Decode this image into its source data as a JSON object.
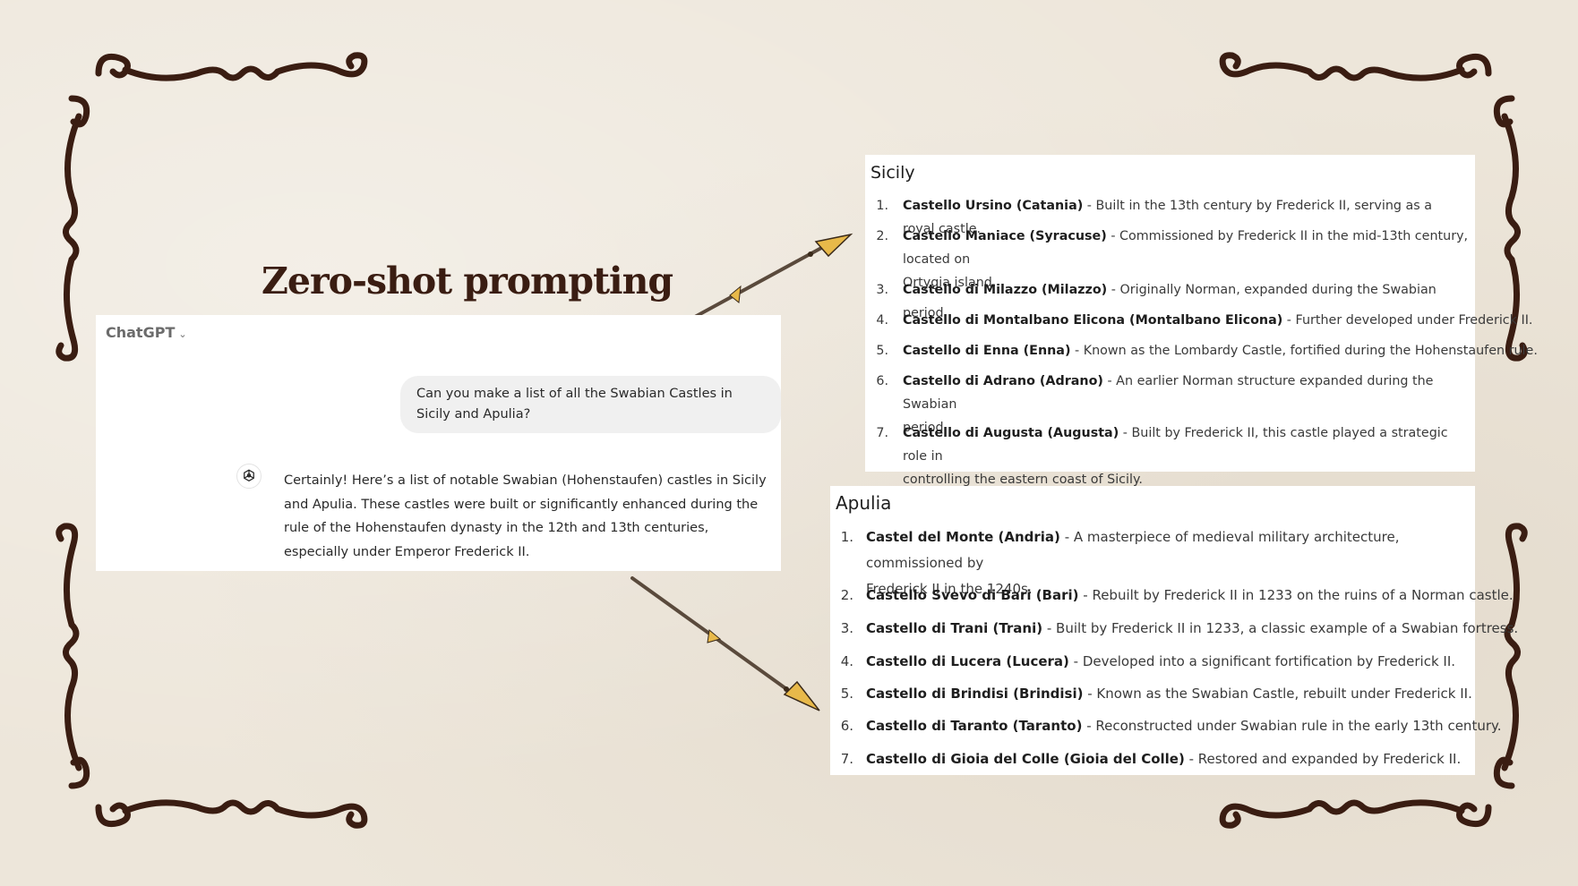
{
  "title": "Zero-shot prompting",
  "chat": {
    "model_label": "ChatGPT",
    "model_chevron": "⌄",
    "user_message": "Can you make a list of all the Swabian Castles in Sicily and Apulia?",
    "assistant_message": "Certainly! Here’s a list of notable Swabian (Hohenstaufen) castles in Sicily and Apulia. These castles were built or significantly enhanced during the rule of the Hohenstaufen dynasty in the 12th and 13th centuries, especially under Emperor Frederick II."
  },
  "sicily": {
    "heading": "Sicily",
    "items": [
      {
        "num": "1.",
        "name": "Castello Ursino (Catania)",
        "desc": " - Built in the 13th century by Frederick II, serving as a royal castle.",
        "cont": ""
      },
      {
        "num": "2.",
        "name": "Castello Maniace (Syracuse)",
        "desc": " - Commissioned by Frederick II in the mid-13th century, located on",
        "cont": "Ortygia island."
      },
      {
        "num": "3.",
        "name": "Castello di Milazzo (Milazzo)",
        "desc": " - Originally Norman, expanded during the Swabian period.",
        "cont": ""
      },
      {
        "num": "4.",
        "name": "Castello di Montalbano Elicona (Montalbano Elicona)",
        "desc": " - Further developed under Frederick II.",
        "cont": ""
      },
      {
        "num": "5.",
        "name": "Castello di Enna (Enna)",
        "desc": " - Known as the Lombardy Castle, fortified during the Hohenstaufen rule.",
        "cont": ""
      },
      {
        "num": "6.",
        "name": "Castello di Adrano (Adrano)",
        "desc": " - An earlier Norman structure expanded during the Swabian",
        "cont": "period."
      },
      {
        "num": "7.",
        "name": "Castello di Augusta (Augusta)",
        "desc": " - Built by Frederick II, this castle played a strategic role in",
        "cont": "controlling the eastern coast of Sicily."
      }
    ]
  },
  "apulia": {
    "heading": "Apulia",
    "items": [
      {
        "num": "1.",
        "name": "Castel del Monte (Andria)",
        "desc": " - A masterpiece of medieval military architecture, commissioned by",
        "cont": "Frederick II in the 1240s."
      },
      {
        "num": "2.",
        "name": "Castello Svevo di Bari (Bari)",
        "desc": " - Rebuilt by Frederick II in 1233 on the ruins of a Norman castle.",
        "cont": ""
      },
      {
        "num": "3.",
        "name": "Castello di Trani (Trani)",
        "desc": " - Built by Frederick II in 1233, a classic example of a Swabian fortress.",
        "cont": ""
      },
      {
        "num": "4.",
        "name": "Castello di Lucera (Lucera)",
        "desc": " - Developed into a significant fortification by Frederick II.",
        "cont": ""
      },
      {
        "num": "5.",
        "name": "Castello di Brindisi (Brindisi)",
        "desc": " - Known as the Swabian Castle, rebuilt under Frederick II.",
        "cont": ""
      },
      {
        "num": "6.",
        "name": "Castello di Taranto (Taranto)",
        "desc": " - Reconstructed under Swabian rule in the early 13th century.",
        "cont": ""
      },
      {
        "num": "7.",
        "name": "Castello di Gioia del Colle (Gioia del Colle)",
        "desc": " - Restored and expanded by Frederick II.",
        "cont": ""
      }
    ]
  },
  "colors": {
    "ornament": "#3a1d12",
    "spear_tip": "#e8b94a",
    "background": "#ede6da"
  }
}
